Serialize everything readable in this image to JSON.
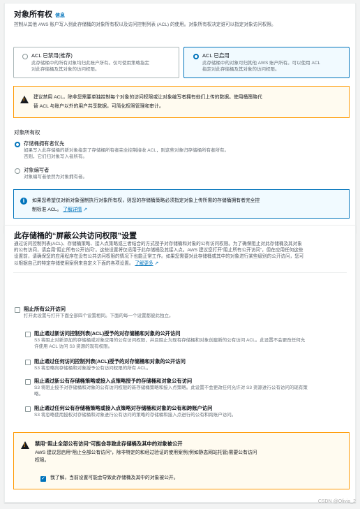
{
  "ownership": {
    "title": "对象所有权",
    "info": "信息",
    "description": "控制从其他 AWS 账户写入到此存储桶的对象所有权以及访问控制列表 (ACL) 的使用。对象所有权决定谁可以指定对象访问权限。",
    "tiles": [
      {
        "title": "ACL 已禁用(推荐)",
        "desc1": "此存储桶中的所有对象均归此账户所有。仅可使用策略指定",
        "desc2": "对此存储桶及其对象的访问权限。",
        "selected": false
      },
      {
        "title": "ACL 已启用",
        "desc1": "此存储桶中的对象可归其他 AWS 账户所有。可以使用 ACL",
        "desc2": "指定对此存储桶及其对象的访问权限。",
        "selected": true
      }
    ],
    "warning": {
      "line1": "建议禁用 ACL，除非您需要单独控制每个对象的访问权限或让对象编写者拥有他们上传的数据。使用桶策略代",
      "line2": "替 ACL 与账户以外的用户共享数据，可简化权限管理和审计。"
    },
    "owner_label": "对象所有权",
    "options": [
      {
        "label": "存储桶拥有者优先",
        "desc1": "如果写入此存储桶的新对象指定了存储桶所有者完全控制接收 ACL，则这些对象归存储桶所有者所有。",
        "desc2": "否则，它们归对象写入者所有。",
        "selected": true
      },
      {
        "label": "对象编写者",
        "desc1": "对象编写者依然为对象拥有者。",
        "selected": false
      }
    ],
    "info_alert": {
      "line1": "如果您希望仅对新对象强制执行对象所有权，则您的存储桶策略必须指定对象上传所需的存储桶拥有者完全控",
      "line2_prefix": "制标准 ACL。",
      "link": "了解详情"
    }
  },
  "block": {
    "title": "此存储桶的“屏蔽公共访问权限”设置",
    "desc_lines": [
      "通过访问控制列表(ACL)、存储桶策略、接入点策略或三者结合的方式授予对存储桶和对象的公有访问权限。为了确保阻止对此存储桶及其对象",
      "的公有访问，请启用“阻止所有公开访问”。这些设置将仅适用于此存储桶及其接入点。AWS 建议您打开“阻止所有公开访问”，但在应用任何这些",
      "设置前，请确保您的应用程序在没有公共访问权限的情况下也能正常工作。如果您需要对此存储桶或其中的对象进行某些级别的公开访问，您可",
      "以根据自己的特定存储使用案例来自定义下面的各项设置。"
    ],
    "learn_more": "了解更多",
    "all": {
      "label": "阻止所有公开访问",
      "desc": "打开此设置与打开下面全部四个设置相同。下面的每一个设置都彼此独立。"
    },
    "items": [
      {
        "label": "阻止通过新访问控制列表(ACL)授予的对存储桶和对象的公开访问",
        "desc1": "S3 将阻止对新添加的存储桶或对象应用的公有访问权限，并且阻止为现有存储桶和对象创建新的公有访问 ACL。此设置不会更改任何允",
        "desc2": "许使用 ACL 访问 S3 资源的现有权限。"
      },
      {
        "label": "阻止通过任何访问控制列表(ACL)授予的对存储桶和对象的公开访问",
        "desc1": "S3 将忽略向存储桶和对象授予公有访问权限的所有 ACL。",
        "desc2": ""
      },
      {
        "label": "阻止通过新公有存储桶策略或接入点策略授予的存储桶和对象公有访问",
        "desc1": "S3 将阻止授予对存储桶和对象的公有访问权限的新存储桶策略和接入点策略。此设置不会更改任何允许对 S3 资源进行公有访问的现有策",
        "desc2": "略。"
      },
      {
        "label": "阻止通过任何公有存储桶策略或接入点策略对存储桶和对象的公有和跨账户访问",
        "desc1": "S3 将忽略使用授权对存储桶和对象进行公有访问的策略的存储桶和接入点进行的公有和跨账户访问。",
        "desc2": ""
      }
    ],
    "alert": {
      "title": "禁用“阻止全部公有访问”可能会导致此存储桶及其中的对象被公开",
      "line1": "AWS 建议您启用“阻止全部公有访问”，除非特定的和经过验证的使用案例(例如静态网站托管)需要公有访问",
      "line2": "权限。",
      "ack": "我了解，当前设置可能会导致此存储桶及其中的对象被公开。"
    }
  },
  "watermark": "CSDN @Olivia_2",
  "colors": {
    "accent": "#0073bb",
    "warning": "#ff9900",
    "background": "#f2f3f3"
  }
}
